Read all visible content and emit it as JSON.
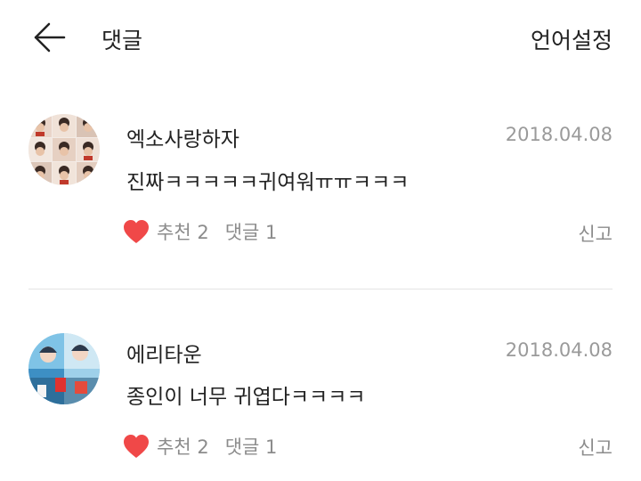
{
  "header": {
    "title": "댓글",
    "language_settings": "언어설정"
  },
  "comments": [
    {
      "username": "엑소사랑하자",
      "date": "2018.04.08",
      "text": "진짜ㅋㅋㅋㅋㅋ귀여워ㅠㅠㅋㅋㅋ",
      "likes": "추천 2",
      "replies": "댓글 1",
      "report": "신고"
    },
    {
      "username": "에리타운",
      "date": "2018.04.08",
      "text": "종인이 너무 귀엽다ㅋㅋㅋㅋ",
      "likes": "추천 2",
      "replies": "댓글 1",
      "report": "신고"
    }
  ],
  "colors": {
    "heart": "#f04848",
    "meta_text": "#8c8c8c",
    "date_text": "#9a9a9a",
    "divider": "#e4e4e4"
  },
  "icons": {
    "back": "arrow-left-icon",
    "like": "heart-icon"
  }
}
